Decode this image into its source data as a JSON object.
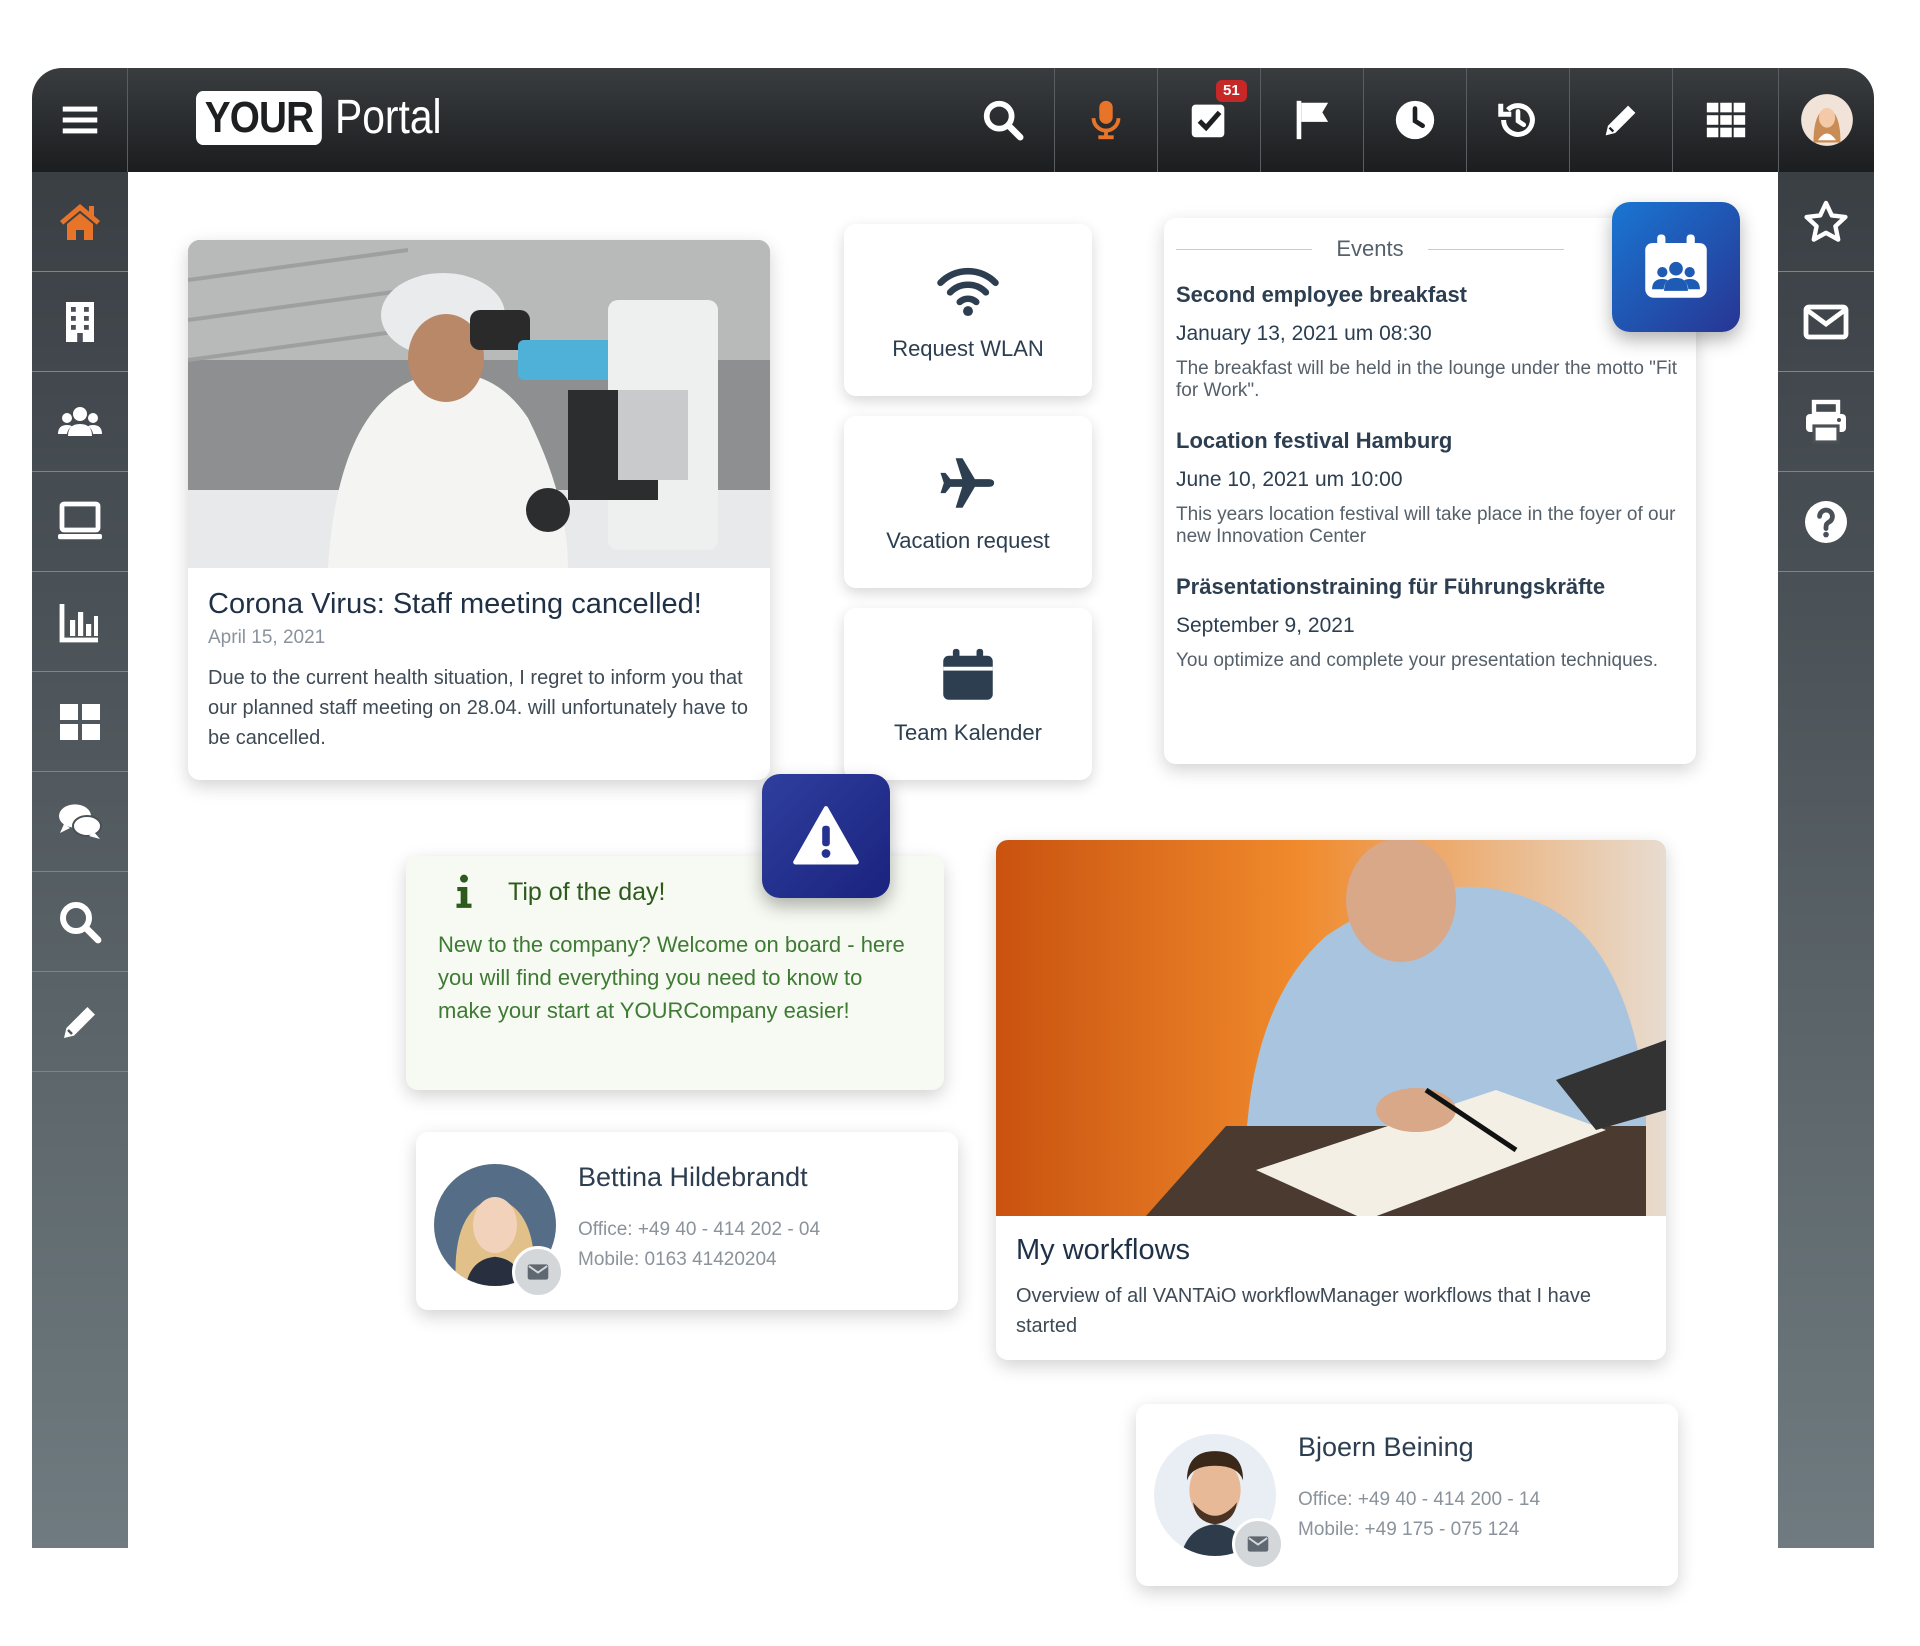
{
  "header": {
    "logo_your": "YOUR",
    "logo_portal": "Portal",
    "tasks_badge": "51",
    "icons": [
      "menu-icon",
      "search-icon",
      "microphone-icon",
      "tasks-icon",
      "flag-icon",
      "clock-icon",
      "history-icon",
      "pencil-icon",
      "apps-grid-icon",
      "user-avatar"
    ]
  },
  "sidebar": {
    "items": [
      "home-icon",
      "building-icon",
      "users-icon",
      "monitor-icon",
      "chart-icon",
      "dashboard-icon",
      "chat-icon",
      "search-icon",
      "pencil-icon"
    ]
  },
  "rightbar": {
    "items": [
      "star-icon",
      "mail-icon",
      "print-icon",
      "help-icon"
    ]
  },
  "news": {
    "title": "Corona Virus: Staff meeting cancelled!",
    "date": "April 15, 2021",
    "body": "Due to the current health situation, I regret to inform you that our planned staff meeting on 28.04. will unfortunately have to be cancelled."
  },
  "quicklinks": {
    "wlan": "Request WLAN",
    "vacation": "Vacation request",
    "calendar": "Team Kalender"
  },
  "events": {
    "heading": "Events",
    "items": [
      {
        "title": "Second employee breakfast",
        "date": "January 13, 2021 um 08:30",
        "desc": "The breakfast will be held in the lounge under the motto \"Fit for Work\"."
      },
      {
        "title": "Location festival Hamburg",
        "date": "June 10, 2021 um 10:00",
        "desc": "This years location festival will take place in the foyer of our new Innovation Center"
      },
      {
        "title": "Präsentationstraining für Führungskräfte",
        "date": "September 9, 2021",
        "desc": "You optimize and complete your presentation techniques."
      }
    ]
  },
  "tip": {
    "title": "Tip of the day!",
    "body": "New to the company? Welcome on board - here you will find everything you need to know to make your start at YOURCompany easier!"
  },
  "contacts": [
    {
      "name": "Bettina Hildebrandt",
      "office": "Office: +49 40 - 414 202 - 04",
      "mobile": "Mobile: 0163 41420204"
    },
    {
      "name": "Bjoern Beining",
      "office": "Office: +49 40 - 414 200 - 14",
      "mobile": "Mobile: +49 175 - 075 124"
    }
  ],
  "workflows": {
    "title": "My workflows",
    "desc": "Overview of all VANTAiO workflowManager workflows that I have started"
  },
  "colors": {
    "accent_orange": "#e8742a",
    "tip_green": "#2e7d32",
    "badge_red": "#c62828",
    "calendar_blue": "#1565c0",
    "warning_indigo": "#303f9f"
  }
}
